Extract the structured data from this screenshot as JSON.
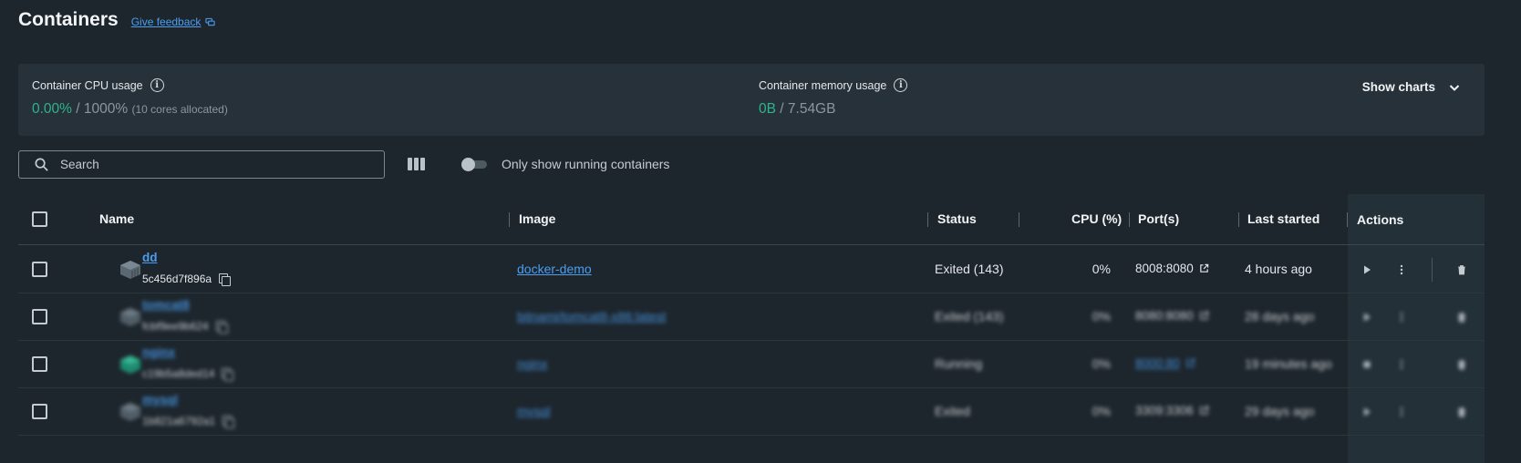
{
  "header": {
    "title": "Containers",
    "feedback_label": "Give feedback"
  },
  "stats": {
    "cpu_label": "Container CPU usage",
    "cpu_used": "0.00%",
    "cpu_total": "/ 1000%",
    "cpu_note": "(10 cores allocated)",
    "mem_label": "Container memory usage",
    "mem_used": "0B",
    "mem_total": "/ 7.54GB",
    "show_charts_label": "Show charts"
  },
  "toolbar": {
    "search_placeholder": "Search",
    "toggle_label": "Only show running containers",
    "toggle_on": false
  },
  "table": {
    "headers": {
      "name": "Name",
      "image": "Image",
      "status": "Status",
      "cpu": "CPU (%)",
      "ports": "Port(s)",
      "last_started": "Last started",
      "actions": "Actions"
    },
    "rows": [
      {
        "name": "dd",
        "id": "5c456d7f896a",
        "image": "docker-demo",
        "status": "Exited (143)",
        "cpu": "0%",
        "port": "8008:8080",
        "port_link": false,
        "last_started": "4 hours ago",
        "running": false
      },
      {
        "name": "tomcat8",
        "id": "fcbf9ee9b624",
        "image": "bitnami/tomcat8-x86:latest",
        "status": "Exited (143)",
        "cpu": "0%",
        "port": "8080:8080",
        "port_link": false,
        "last_started": "28 days ago",
        "running": false
      },
      {
        "name": "nginx",
        "id": "c19b5a8ded14",
        "image": "nginx",
        "status": "Running",
        "cpu": "0%",
        "port": "8000:80",
        "port_link": true,
        "last_started": "19 minutes ago",
        "running": true
      },
      {
        "name": "mysql",
        "id": "1b821a6792a1",
        "image": "mysql",
        "status": "Exited",
        "cpu": "0%",
        "port": "3309:3306",
        "port_link": false,
        "last_started": "29 days ago",
        "running": false
      }
    ]
  },
  "colors": {
    "background": "#1d262d",
    "panel": "#273139",
    "accent_green": "#2fb38e",
    "link_blue": "#4b9ef0"
  }
}
